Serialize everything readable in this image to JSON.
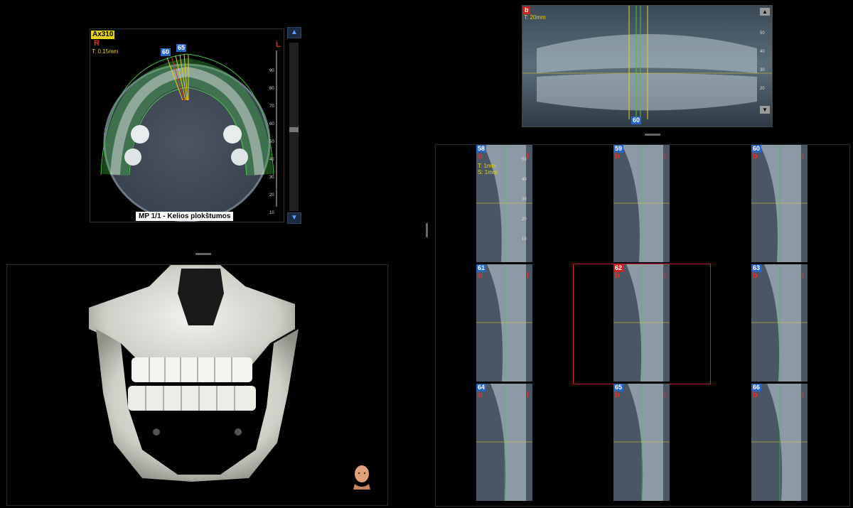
{
  "axial": {
    "view_tag": "Ax310",
    "side_right": "R",
    "side_left": "L",
    "thickness": "T: 0.15mm",
    "markers": [
      "60",
      "65"
    ],
    "scale_ticks": [
      "90",
      "80",
      "70",
      "60",
      "50",
      "40",
      "30",
      "20",
      "10"
    ],
    "caption": "MP 1/1 - Kelios plokštumos",
    "scroll_up": "▲",
    "scroll_down": "▼"
  },
  "panoramic": {
    "marker_top": "b",
    "thickness": "T: 20mm",
    "marker_bottom": "60",
    "scale_ticks": [
      "50",
      "40",
      "30",
      "20"
    ],
    "scroll_up": "▲",
    "scroll_down": "▼"
  },
  "cross_sections": {
    "side_b": "b",
    "side_l": "l",
    "thickness": "T: 1mm",
    "spacing": "S: 1mm",
    "scale_ticks": [
      "50",
      "40",
      "30",
      "20",
      "10"
    ],
    "selected": "62",
    "slices": [
      "58",
      "59",
      "60",
      "61",
      "62",
      "63",
      "64",
      "65",
      "66"
    ]
  },
  "volume": {
    "orientation_icon": "head-orientation-icon"
  },
  "colors": {
    "accent_blue": "#2a66c8",
    "marker_red": "#d02020",
    "label_yellow": "#e8d21a",
    "selection_red": "#d02020",
    "curve_green": "#49c24a"
  }
}
